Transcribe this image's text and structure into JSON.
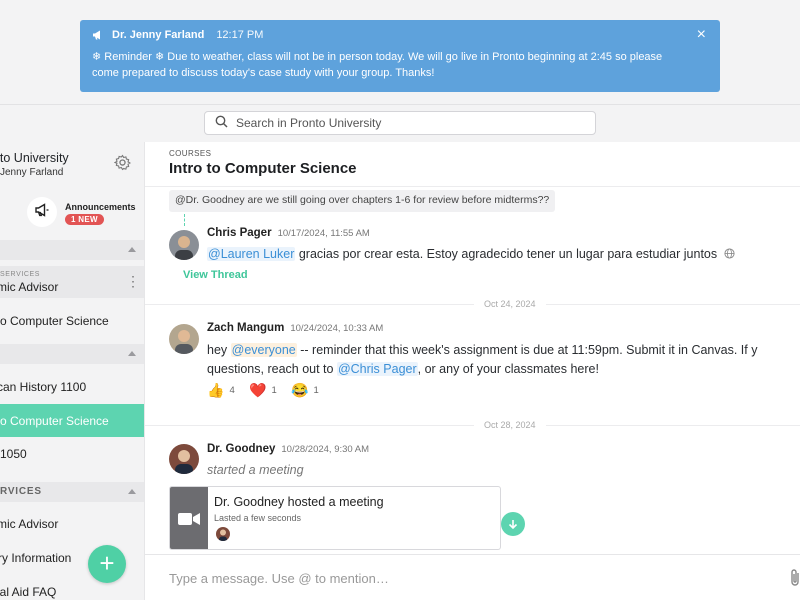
{
  "banner": {
    "sender": "Dr. Jenny Farland",
    "time": "12:17 PM",
    "message_line1": "❄ Reminder ❄ Due to weather, class will not be in person today. We will go live in Pronto beginning at 2:45 so please",
    "message_line2": "come prepared to discuss today's case study with your group. Thanks!",
    "close_icon": "×"
  },
  "search": {
    "placeholder": "Search in Pronto University"
  },
  "sidebar": {
    "org_name": "onto University",
    "org_user": "Jenny Farland",
    "announcements_label": "Announcements",
    "announcements_badge": "1 NEW",
    "services_small_label": "SERVICES",
    "academic_advisor_1": "mic Advisor",
    "intro_cs_1": "o Computer Science",
    "american_history": "can History 1100",
    "intro_cs_active": "o Computer Science",
    "item_1050": "1050",
    "services_label": "RVICES",
    "academic_advisor_2": "mic Advisor",
    "library_info": "ry Information",
    "financial_aid": "ial Aid FAQ",
    "fab_label": "+"
  },
  "main": {
    "breadcrumb": "COURSES",
    "title": "Intro to Computer Science",
    "quoted_message": "@Dr. Goodney are we still going over chapters 1-6 for review before midterms??",
    "messages": [
      {
        "name": "Chris Pager",
        "time": "10/17/2024, 11:55 AM",
        "mention": "@Lauren Luker",
        "text": " gracias por crear esta. Estoy agradecido tener un lugar para estudiar juntos",
        "view_thread": "View Thread"
      },
      {
        "name": "Zach Mangum",
        "time": "10/24/2024, 10:33 AM",
        "line1_pre": "hey ",
        "line1_mention": "@everyone",
        "line1_post": " -- reminder that this week's assignment is due at 11:59pm. Submit it in Canvas. If y",
        "line2_pre": "questions, reach out to ",
        "line2_mention": "@Chris Pager",
        "line2_post": ", or any of your classmates here!",
        "reactions": [
          {
            "emoji": "👍",
            "count": "4"
          },
          {
            "emoji": "❤️",
            "count": "1"
          },
          {
            "emoji": "😂",
            "count": "1"
          }
        ]
      },
      {
        "name": "Dr. Goodney",
        "time": "10/28/2024, 9:30 AM",
        "text": "started a meeting",
        "meeting_title": "Dr. Goodney hosted a meeting",
        "meeting_sub": "Lasted a few seconds"
      }
    ],
    "date_separators": [
      "Oct 24, 2024",
      "Oct 28, 2024"
    ],
    "compose_placeholder": "Type a message. Use @ to mention…"
  },
  "colors": {
    "banner": "#5ea2dc",
    "accent": "#5dd4b0",
    "mention": "#3b8fd6",
    "badge": "#e25454"
  },
  "icons": [
    "megaphone-icon",
    "gear-icon",
    "search-icon",
    "close-icon",
    "video-camera-icon",
    "arrow-down-icon",
    "paperclip-icon",
    "globe-icon",
    "plus-icon"
  ]
}
